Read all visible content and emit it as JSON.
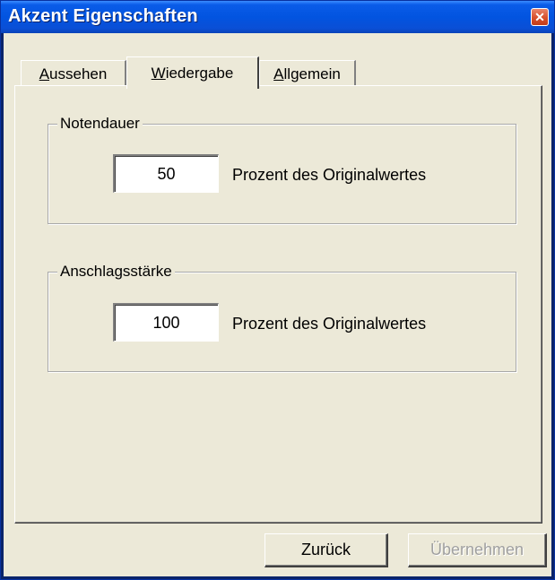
{
  "window": {
    "title": "Akzent Eigenschaften",
    "close_glyph": "✕"
  },
  "tabs": [
    {
      "label": "Aussehen",
      "mnemonic": "A",
      "rest": "ussehen",
      "active": false
    },
    {
      "label": "Wiedergabe",
      "mnemonic": "W",
      "rest": "iedergabe",
      "active": true
    },
    {
      "label": "Allgemein",
      "mnemonic": "A",
      "rest": "llgemein",
      "active": false
    }
  ],
  "groups": {
    "notendauer": {
      "legend": "Notendauer",
      "value": "50",
      "suffix": "Prozent des Originalwertes"
    },
    "anschlagsstaerke": {
      "legend": "Anschlagsstärke",
      "value": "100",
      "suffix": "Prozent des Originalwertes"
    }
  },
  "buttons": {
    "back_label": "Zurück",
    "apply_label": "Übernehmen",
    "apply_enabled": false
  },
  "colors": {
    "titlebar": "#0a5ce8",
    "dialog_face": "#ece9d8",
    "close_button": "#d8502c"
  },
  "icons": {
    "close": "close-icon"
  }
}
